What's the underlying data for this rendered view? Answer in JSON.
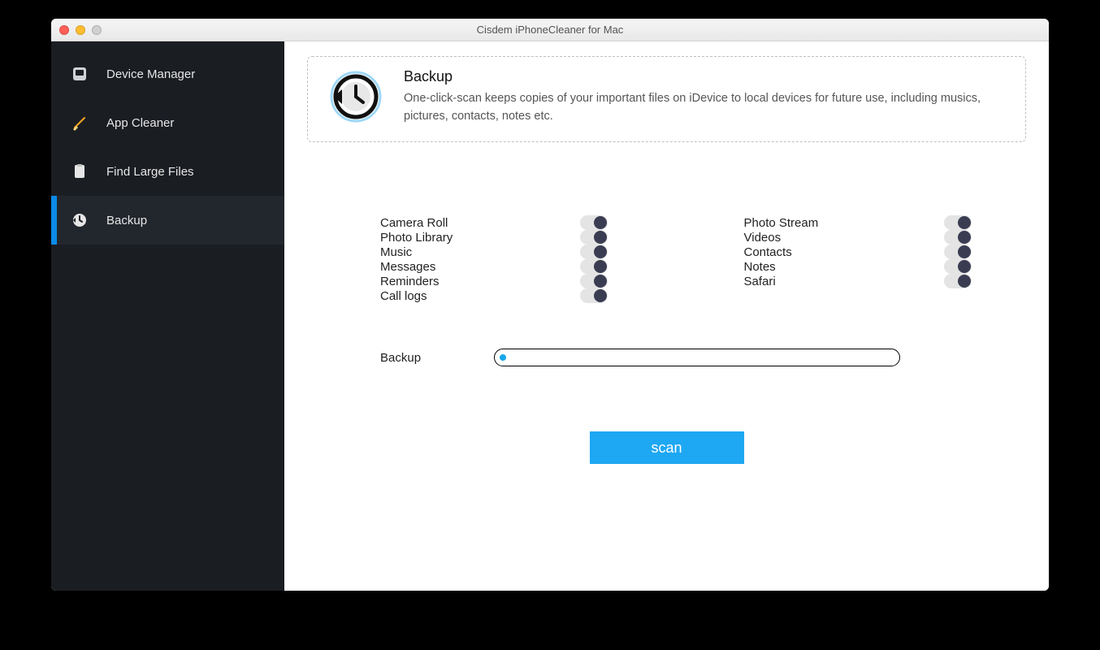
{
  "window": {
    "title": "Cisdem iPhoneCleaner for Mac"
  },
  "sidebar": {
    "items": [
      {
        "label": "Device Manager",
        "icon": "device-icon",
        "active": false
      },
      {
        "label": "App Cleaner",
        "icon": "broom-icon",
        "active": false
      },
      {
        "label": "Find Large Files",
        "icon": "clipboard-icon",
        "active": false
      },
      {
        "label": "Backup",
        "icon": "backup-icon",
        "active": true
      }
    ]
  },
  "info": {
    "title": "Backup",
    "description": "One-click-scan keeps copies of your important files on iDevice to local devices for future use, including musics, pictures, contacts, notes etc."
  },
  "options": {
    "left": [
      {
        "label": "Camera Roll",
        "on": true
      },
      {
        "label": "Photo Library",
        "on": true
      },
      {
        "label": "Music",
        "on": true
      },
      {
        "label": "Messages",
        "on": true
      },
      {
        "label": "Reminders",
        "on": true
      },
      {
        "label": "Call logs",
        "on": true
      }
    ],
    "right": [
      {
        "label": "Photo Stream",
        "on": true
      },
      {
        "label": "Videos",
        "on": true
      },
      {
        "label": "Contacts",
        "on": true
      },
      {
        "label": "Notes",
        "on": true
      },
      {
        "label": "Safari",
        "on": true
      }
    ]
  },
  "backup_path": {
    "label": "Backup"
  },
  "scan_button": {
    "label": "scan"
  },
  "colors": {
    "accent": "#1ea7f2",
    "sidebar_bg": "#1a1d22"
  }
}
